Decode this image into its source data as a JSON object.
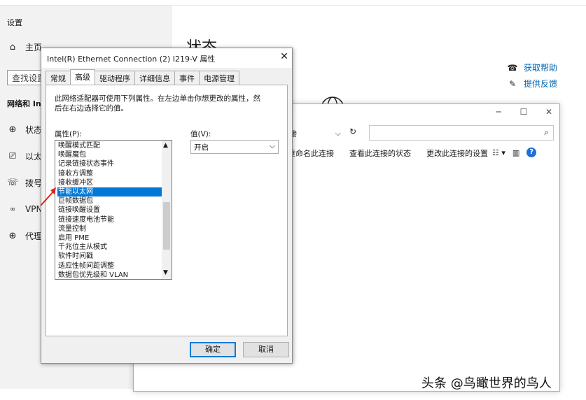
{
  "settings": {
    "window_title": "设置",
    "home_label": "主页",
    "search_placeholder": "查找设置",
    "section_label": "网络和 Inte",
    "nav": [
      {
        "icon": "status-icon",
        "label": "状态"
      },
      {
        "icon": "ethernet-icon",
        "label": "以太网"
      },
      {
        "icon": "dialup-icon",
        "label": "拨号"
      },
      {
        "icon": "vpn-icon",
        "label": "VPN"
      },
      {
        "icon": "proxy-icon",
        "label": "代理"
      }
    ],
    "page_heading": "状态",
    "help_links": [
      {
        "icon": "help-icon",
        "label": "获取帮助"
      },
      {
        "icon": "feedback-icon",
        "label": "提供反馈"
      }
    ]
  },
  "network_window": {
    "address_tail": "接",
    "toolbar": [
      "重命名此连接",
      "查看此连接的状态",
      "更改此连接的设置"
    ]
  },
  "dialog": {
    "title": "Intel(R) Ethernet Connection (2) I219-V 属性",
    "tabs": [
      "常规",
      "高级",
      "驱动程序",
      "详细信息",
      "事件",
      "电源管理"
    ],
    "active_tab": "高级",
    "description": "此网络适配器可使用下列属性。在左边单击你想更改的属性，然后在右边选择它的值。",
    "property_label": "属性(P):",
    "value_label": "值(V):",
    "properties": [
      "唤醒模式匹配",
      "唤醒魔包",
      "记录链接状态事件",
      "接收方调整",
      "接收缓冲区",
      "节能以太网",
      "巨帧数据包",
      "链接唤醒设置",
      "链接速度电池节能",
      "流量控制",
      "启用 PME",
      "千兆位主从模式",
      "软件时间戳",
      "适应性帧间距调整",
      "数据包优先级和 VLAN"
    ],
    "selected_property": "节能以太网",
    "value": "开启",
    "ok_label": "确定",
    "cancel_label": "取消"
  },
  "watermark": "头条 @鸟瞰世界的鸟人",
  "colors": {
    "accent": "#0078d7",
    "link": "#0066b4",
    "annotation": "#e02020"
  }
}
